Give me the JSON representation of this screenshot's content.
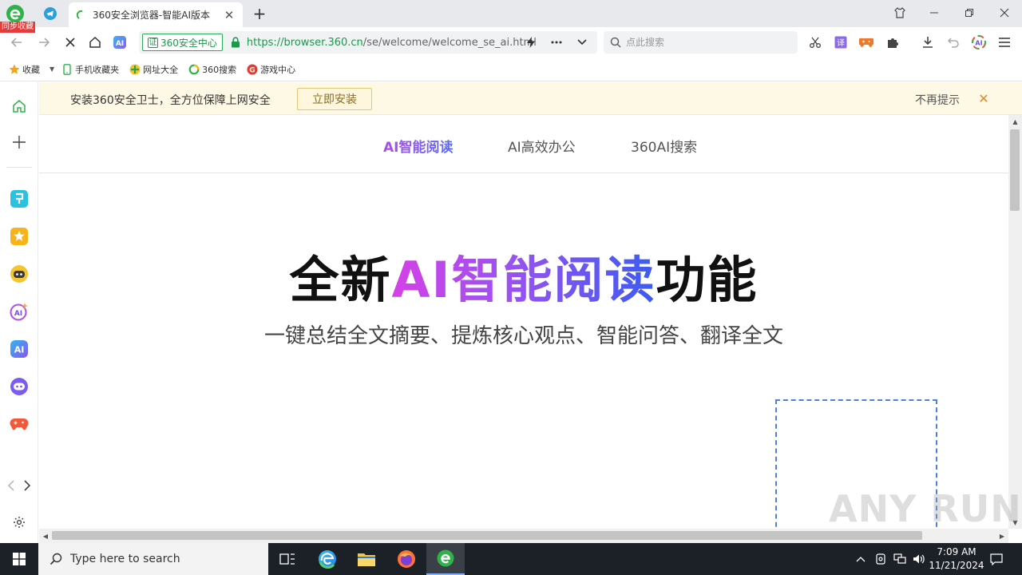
{
  "browser": {
    "sync_badge": "同步收藏",
    "active_tab_title": "360安全浏览器-智能AI版本",
    "new_tab_symbol": "+"
  },
  "toolbar": {
    "security_badge_zheng": "证",
    "security_badge": "360安全中心",
    "url_scheme_host": "https://browser.360.cn",
    "url_path": "/se/welcome/welcome_se_ai.html",
    "search_placeholder": "点此搜索"
  },
  "bookmarks": {
    "items": [
      {
        "label": "收藏",
        "icon": "star-icon"
      },
      {
        "label": "手机收藏夹",
        "icon": "phone-icon"
      },
      {
        "label": "网址大全",
        "icon": "sites-icon"
      },
      {
        "label": "360搜索",
        "icon": "search-360-icon"
      },
      {
        "label": "游戏中心",
        "icon": "game-center-icon"
      }
    ]
  },
  "infobar": {
    "message": "安装360安全卫士，全方位保障上网安全",
    "install_label": "立即安装",
    "dismiss_label": "不再提示"
  },
  "page": {
    "nav": [
      {
        "label": "AI智能阅读",
        "active": true
      },
      {
        "label": "AI高效办公",
        "active": false
      },
      {
        "label": "360AI搜索",
        "active": false
      }
    ],
    "hero_prefix": "全新",
    "hero_highlight": "AI智能阅读",
    "hero_suffix": "功能",
    "subtitle": "一键总结全文摘要、提炼核心观点、智能问答、翻译全文"
  },
  "watermark": "ANY RUN",
  "taskbar": {
    "search_placeholder": "Type here to search",
    "time": "7:09 AM",
    "date": "11/21/2024"
  },
  "colors": {
    "accent_green": "#1a9a4b",
    "hero_gradient_start": "#d541e6",
    "hero_gradient_end": "#3a5cf2",
    "infobar_bg": "#fef9e5"
  }
}
